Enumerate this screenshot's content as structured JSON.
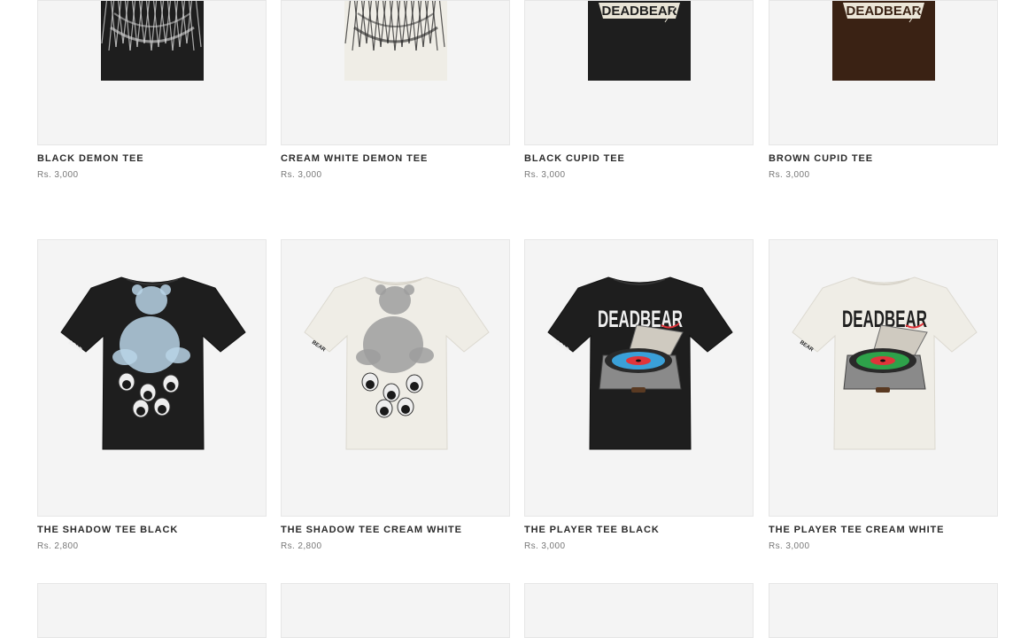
{
  "products": [
    {
      "title": "BLACK DEMON TEE",
      "price": "Rs. 3,000",
      "garment_color": "#1e1e1e",
      "print": "demon",
      "print_color": "#dcdcdc"
    },
    {
      "title": "CREAM WHITE DEMON TEE",
      "price": "Rs. 3,000",
      "garment_color": "#efede6",
      "print": "demon",
      "print_color": "#222222"
    },
    {
      "title": "BLACK CUPID TEE",
      "price": "Rs. 3,000",
      "garment_color": "#1e1e1e",
      "print": "cupid",
      "print_color": "#e9e4d6"
    },
    {
      "title": "BROWN CUPID TEE",
      "price": "Rs. 3,000",
      "garment_color": "#3a2214",
      "print": "cupid",
      "print_color": "#ece6d8"
    },
    {
      "title": "THE SHADOW TEE BLACK",
      "price": "Rs. 2,800",
      "garment_color": "#1e1e1e",
      "print": "shadow",
      "print_color": "#b9d4e6",
      "sleeve_text": "BEAR"
    },
    {
      "title": "THE SHADOW TEE CREAM WHITE",
      "price": "Rs. 2,800",
      "garment_color": "#efede6",
      "print": "shadow",
      "print_color": "#9e9e9e",
      "sleeve_text": "BEAR"
    },
    {
      "title": "THE PLAYER TEE BLACK",
      "price": "Rs. 3,000",
      "garment_color": "#1e1e1e",
      "print": "player",
      "print_color": "#f0f0f0",
      "sleeve_text": "BEAR",
      "logo_text": "DEADBEAR"
    },
    {
      "title": "THE PLAYER TEE CREAM WHITE",
      "price": "Rs. 3,000",
      "garment_color": "#efede6",
      "print": "player",
      "print_color": "#1f1f1f",
      "sleeve_text": "BEAR",
      "logo_text": "DEADBEAR"
    },
    {
      "title": "",
      "price": ""
    },
    {
      "title": "",
      "price": ""
    },
    {
      "title": "",
      "price": ""
    },
    {
      "title": "",
      "price": ""
    }
  ],
  "cupid_logo_text": "DEADBEAR",
  "accent_red": "#e0343a",
  "accent_green": "#2ea24a",
  "accent_blue": "#3aa0d8"
}
